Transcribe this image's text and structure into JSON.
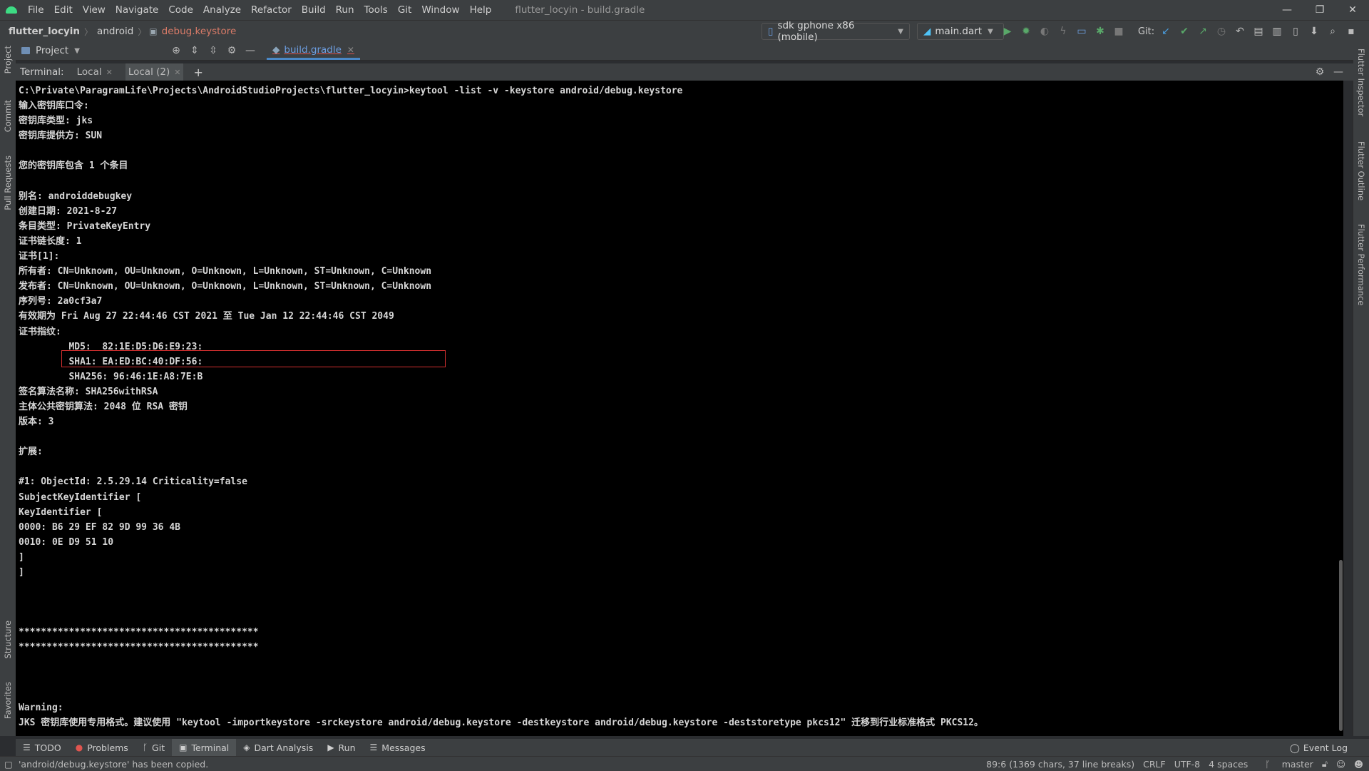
{
  "window": {
    "title": "flutter_locyin - build.gradle",
    "menu": [
      "File",
      "Edit",
      "View",
      "Navigate",
      "Code",
      "Analyze",
      "Refactor",
      "Build",
      "Run",
      "Tools",
      "Git",
      "Window",
      "Help"
    ],
    "controls": [
      "—",
      "❐",
      "✕"
    ]
  },
  "navbar": {
    "breadcrumbs": [
      "flutter_locyin",
      "android",
      "debug.keystore"
    ],
    "device": "sdk gphone x86 (mobile)",
    "run_config": "main.dart",
    "git_label": "Git:"
  },
  "project_panel": {
    "label": "Project",
    "editor_tab": "build.gradle"
  },
  "terminal": {
    "label": "Terminal:",
    "tabs": [
      "Local",
      "Local (2)"
    ],
    "plus": "+",
    "lines": [
      "C:\\Private\\ParagramLife\\Projects\\AndroidStudioProjects\\flutter_locyin>keytool -list -v -keystore android/debug.keystore",
      "输入密钥库口令:",
      "密钥库类型: jks",
      "密钥库提供方: SUN",
      "",
      "您的密钥库包含 1 个条目",
      "",
      "别名: androiddebugkey",
      "创建日期: 2021-8-27",
      "条目类型: PrivateKeyEntry",
      "证书链长度: 1",
      "证书[1]:",
      "所有者: CN=Unknown, OU=Unknown, O=Unknown, L=Unknown, ST=Unknown, C=Unknown",
      "发布者: CN=Unknown, OU=Unknown, O=Unknown, L=Unknown, ST=Unknown, C=Unknown",
      "序列号: 2a0cf3a7",
      "有效期为 Fri Aug 27 22:44:46 CST 2021 至 Tue Jan 12 22:44:46 CST 2049",
      "证书指纹:",
      "         MD5:  82:1E:D5:D6:E9:23:",
      "         SHA1: EA:ED:BC:40:DF:56:",
      "         SHA256: 96:46:1E:A8:7E:B",
      "签名算法名称: SHA256withRSA",
      "主体公共密钥算法: 2048 位 RSA 密钥",
      "版本: 3",
      "",
      "扩展:",
      "",
      "#1: ObjectId: 2.5.29.14 Criticality=false",
      "SubjectKeyIdentifier [",
      "KeyIdentifier [",
      "0000: B6 29 EF 82 9D 99 36 4B",
      "0010: 0E D9 51 10",
      "]",
      "]",
      "",
      "",
      "",
      "*******************************************",
      "*******************************************",
      "",
      "",
      "",
      "Warning:",
      "JKS 密钥库使用专用格式。建议使用 \"keytool -importkeystore -srckeystore android/debug.keystore -destkeystore android/debug.keystore -deststoretype pkcs12\" 迁移到行业标准格式 PKCS12。"
    ]
  },
  "left_stripe": [
    "Project",
    "Commit",
    "Pull Requests",
    "Structure",
    "Favorites"
  ],
  "right_stripe": [
    "Flutter Inspector",
    "Flutter Outline",
    "Flutter Performance"
  ],
  "bottom_tabs": [
    "TODO",
    "Problems",
    "Git",
    "Terminal",
    "Dart Analysis",
    "Run",
    "Messages"
  ],
  "event_log": "Event Log",
  "status": {
    "message": "'android/debug.keystore' has been copied.",
    "position": "89:6 (1369 chars, 37 line breaks)",
    "line_sep": "CRLF",
    "encoding": "UTF-8",
    "indent": "4 spaces",
    "branch": "master"
  },
  "colors": {
    "highlight_box": "#d32f2f",
    "android_green": "#3ddc84",
    "run_green": "#59a869"
  }
}
